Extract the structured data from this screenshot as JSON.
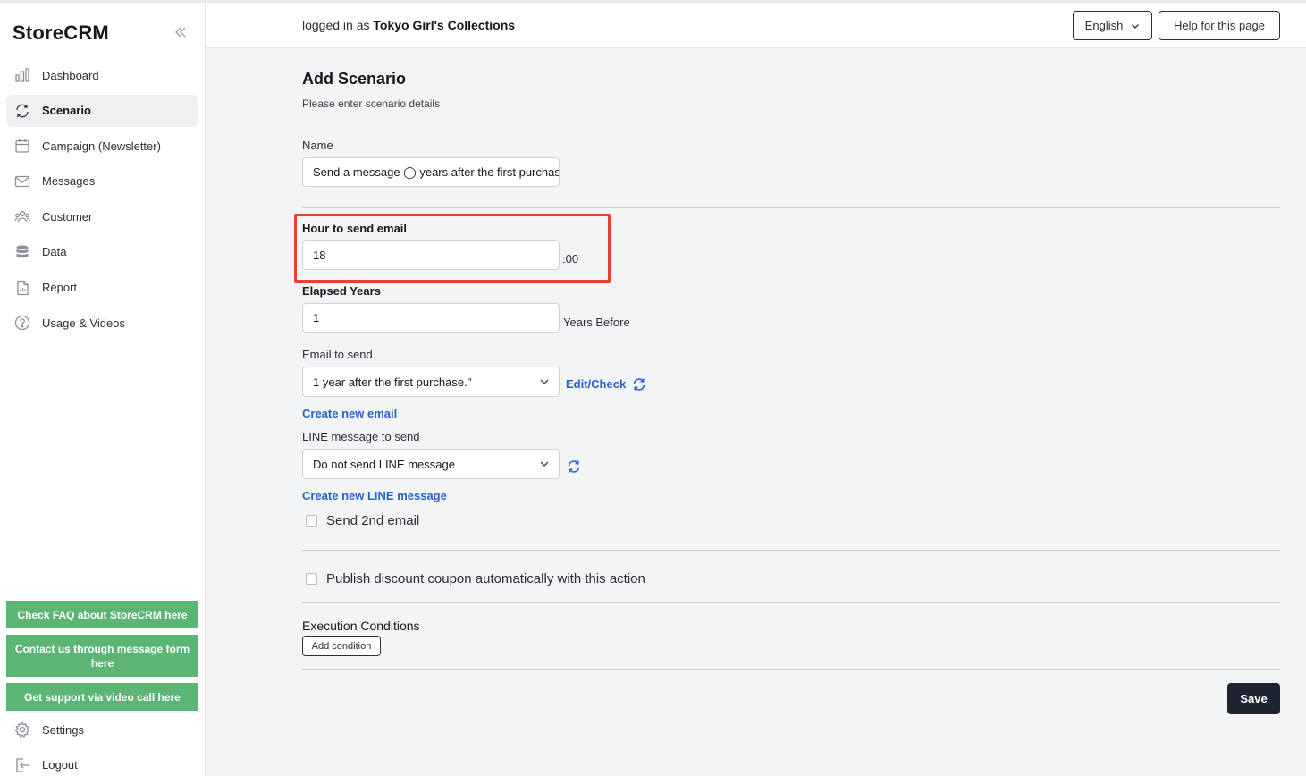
{
  "app": {
    "name": "StoreCRM"
  },
  "sidebar": {
    "items": [
      {
        "label": "Dashboard",
        "icon": "bar-chart-icon",
        "active": false
      },
      {
        "label": "Scenario",
        "icon": "refresh-icon",
        "active": true
      },
      {
        "label": "Campaign (Newsletter)",
        "icon": "calendar-icon",
        "active": false
      },
      {
        "label": "Messages",
        "icon": "mail-icon",
        "active": false
      },
      {
        "label": "Customer",
        "icon": "users-icon",
        "active": false
      },
      {
        "label": "Data",
        "icon": "database-icon",
        "active": false
      },
      {
        "label": "Report",
        "icon": "report-icon",
        "active": false
      },
      {
        "label": "Usage & Videos",
        "icon": "help-icon",
        "active": false
      }
    ],
    "support": {
      "faq": "Check FAQ about StoreCRM here",
      "contact": "Contact us through message form here",
      "video": "Get support via video call here"
    },
    "settings": "Settings",
    "logout": "Logout"
  },
  "header": {
    "logged_prefix": "logged in as",
    "store_name": "Tokyo Girl's Collections",
    "language": "English",
    "help": "Help for this page"
  },
  "form": {
    "title": "Add Scenario",
    "subtitle": "Please enter scenario details",
    "name_label": "Name",
    "name_value": "Send a message ◯ years after the first purchase",
    "hour_label": "Hour to send email",
    "hour_value": "18",
    "hour_suffix": ":00",
    "years_label": "Elapsed Years",
    "years_value": "1",
    "years_suffix": "Years Before",
    "email_label": "Email to send",
    "email_value": "1 year after the first purchase.\"",
    "edit_check": "Edit/Check",
    "create_email": "Create new email",
    "line_label": "LINE message to send",
    "line_value": "Do not send LINE message",
    "create_line": "Create new LINE message",
    "second_email": "Send 2nd email",
    "coupon": "Publish discount coupon automatically with this action",
    "conditions_title": "Execution Conditions",
    "add_condition": "Add condition",
    "save": "Save"
  },
  "colors": {
    "accent": "#2563c9",
    "support_green": "#5cb574",
    "highlight": "#e8412c",
    "save_bg": "#1e2430"
  }
}
